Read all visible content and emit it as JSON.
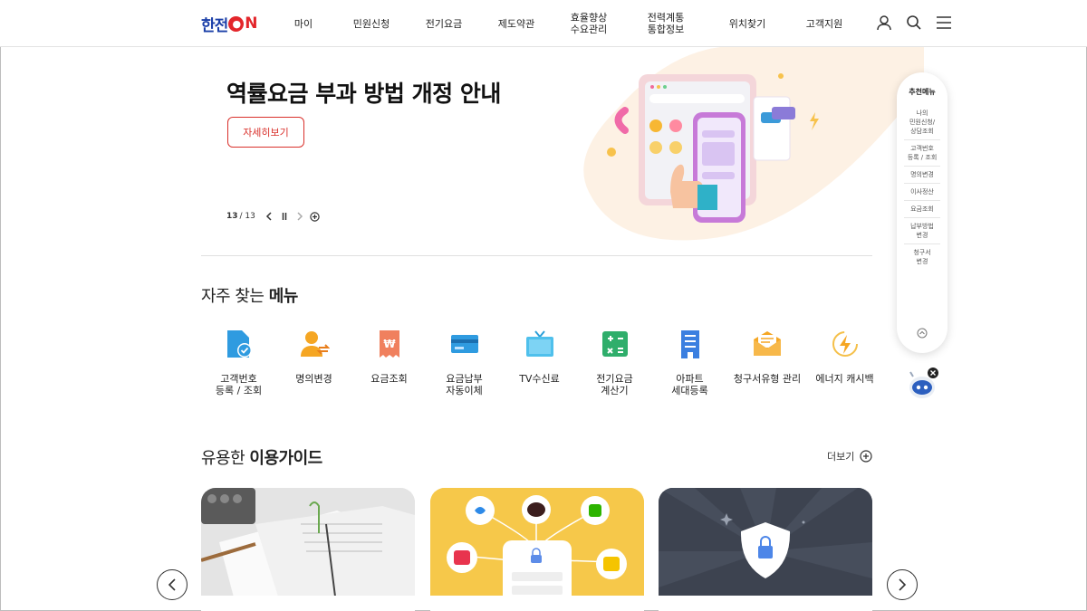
{
  "header": {
    "logo_text": "한전",
    "logo_on": "N",
    "nav": [
      "마이",
      "민원신청",
      "전기요금",
      "제도약관",
      "효율향상\n수요관리",
      "전력계통\n통합정보",
      "위치찾기",
      "고객지원"
    ]
  },
  "hero": {
    "title": "역률요금 부과 방법 개정 안내",
    "button": "자세히보기",
    "page_current": "13",
    "page_total": "/ 13"
  },
  "frequent": {
    "title_plain": "자주 찾는 ",
    "title_bold": "메뉴",
    "items": [
      {
        "label": "고객번호\n등록 / 조회",
        "icon": "customer-number-icon"
      },
      {
        "label": "명의변경",
        "icon": "name-change-icon"
      },
      {
        "label": "요금조회",
        "icon": "bill-inquiry-icon"
      },
      {
        "label": "요금납부\n자동이체",
        "icon": "auto-transfer-card-icon"
      },
      {
        "label": "TV수신료",
        "icon": "tv-icon"
      },
      {
        "label": "전기요금\n계산기",
        "icon": "calculator-icon"
      },
      {
        "label": "아파트\n세대등록",
        "icon": "apartment-icon"
      },
      {
        "label": "청구서유형 관리",
        "icon": "envelope-icon"
      },
      {
        "label": "에너지 캐시백",
        "icon": "energy-cashback-icon"
      }
    ]
  },
  "guide": {
    "title_plain": "유용한 ",
    "title_bold": "이용가이드",
    "more": "더보기"
  },
  "side_menu": {
    "title": "추천메뉴",
    "items": [
      "나의\n민원신청/\n상담조회",
      "고객번호\n등록 / 조회",
      "명의변경",
      "이사정산",
      "요금조회",
      "납부방법\n변경",
      "청구서\n변경"
    ]
  },
  "colors": {
    "brand_blue": "#1b3fa8",
    "brand_red": "#e3262b",
    "accent_red": "#d9302b",
    "card2_bg": "#f6c84a",
    "card3_bg": "#3d4350"
  }
}
